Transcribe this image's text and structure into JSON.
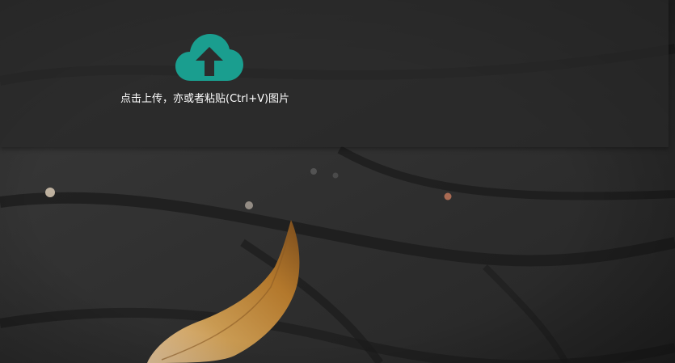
{
  "upload": {
    "icon": "cloud-upload-icon",
    "icon_color": "#1a9e8f",
    "prompt_text": "点击上传，亦或者粘贴(Ctrl+V)图片"
  },
  "background": {
    "description_icon": "leaf-on-pavement-image"
  }
}
